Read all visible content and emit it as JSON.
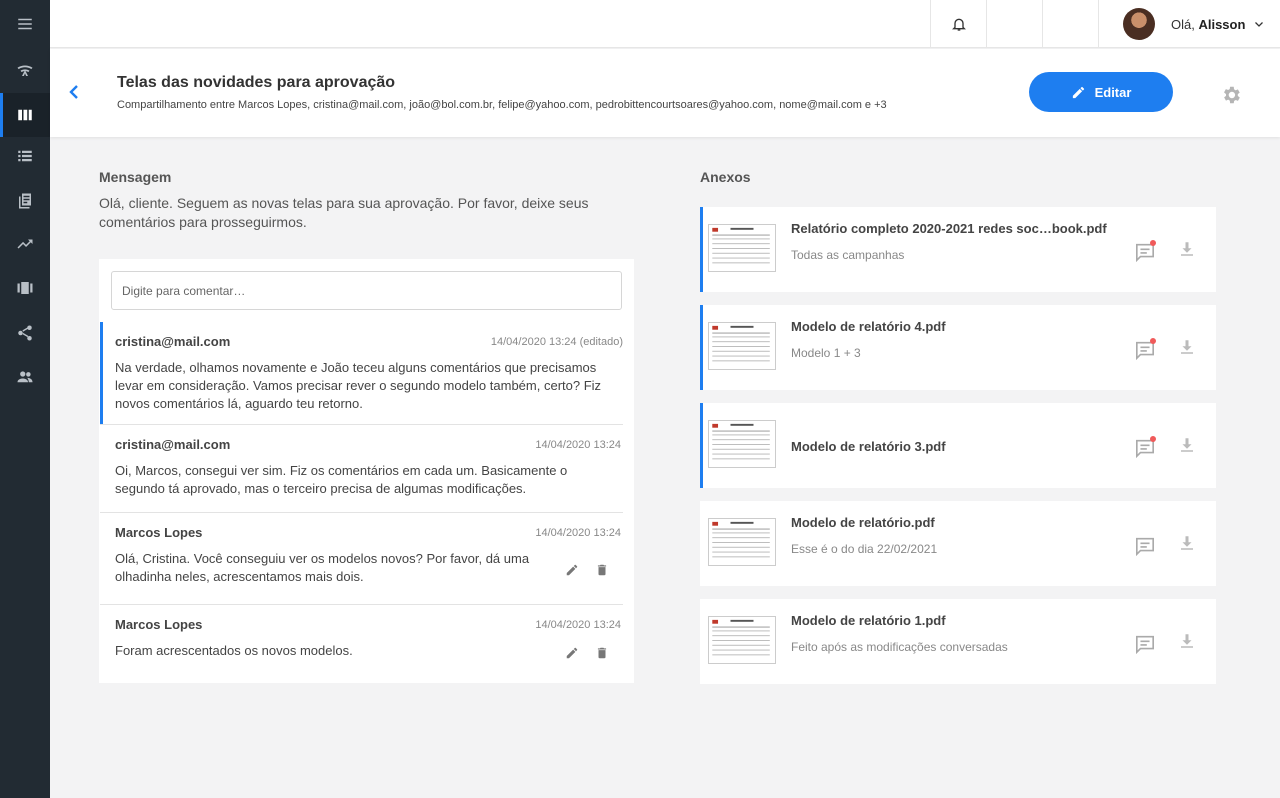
{
  "nav": {
    "items": [
      {
        "icon": "menu-icon"
      },
      {
        "icon": "signal-icon"
      },
      {
        "icon": "columns-icon",
        "active": true
      },
      {
        "icon": "list-icon"
      },
      {
        "icon": "book-icon"
      },
      {
        "icon": "trending-icon"
      },
      {
        "icon": "carousel-icon"
      },
      {
        "icon": "share-icon"
      },
      {
        "icon": "people-icon"
      }
    ]
  },
  "topbar": {
    "greeting_prefix": "Olá,",
    "user_name": "Alisson"
  },
  "header": {
    "title": "Telas das novidades para aprovação",
    "subtitle": "Compartilhamento entre Marcos Lopes, cristina@mail.com, joão@bol.com.br, felipe@yahoo.com, pedrobittencourtsoares@yahoo.com, nome@mail.com e +3",
    "edit_label": "Editar"
  },
  "message": {
    "label": "Mensagem",
    "text": "Olá, cliente. Seguem as novas telas para sua aprovação. Por favor, deixe seus comentários para prosseguirmos."
  },
  "comments": {
    "placeholder": "Digite para comentar…",
    "items": [
      {
        "author": "cristina@mail.com",
        "date": "14/04/2020 13:24 (editado)",
        "body": "Na verdade, olhamos novamente e João teceu alguns comentários que precisamos levar em consideração. Vamos precisar rever o segundo modelo também, certo? Fiz novos comentários lá, aguardo teu retorno."
      },
      {
        "author": "cristina@mail.com",
        "date": "14/04/2020 13:24",
        "body": "Oi, Marcos, consegui ver sim. Fiz os comentários em cada um. Basicamente o segundo tá aprovado, mas o terceiro precisa de algumas modificações."
      },
      {
        "author": "Marcos Lopes",
        "date": "14/04/2020 13:24",
        "body": "Olá, Cristina. Você conseguiu ver os modelos novos? Por favor, dá uma olhadinha neles, acrescentamos mais dois."
      },
      {
        "author": "Marcos Lopes",
        "date": "14/04/2020 13:24",
        "body": "Foram acrescentados os novos modelos."
      }
    ]
  },
  "attachments": {
    "label": "Anexos",
    "items": [
      {
        "name": "Relatório completo 2020-2021 redes soc…book.pdf",
        "desc": "Todas as campanhas",
        "new_comments": true
      },
      {
        "name": "Modelo de relatório 4.pdf",
        "desc": "Modelo 1 + 3",
        "new_comments": true
      },
      {
        "name": "Modelo de relatório 3.pdf",
        "desc": "",
        "new_comments": true
      },
      {
        "name": "Modelo de relatório.pdf",
        "desc": "Esse é o do dia 22/02/2021",
        "new_comments": false
      },
      {
        "name": "Modelo de relatório 1.pdf",
        "desc": "Feito após as modificações conversadas",
        "new_comments": false
      }
    ]
  },
  "colors": {
    "accent": "#1e7ef0",
    "sidebar": "#222b33",
    "notification_dot": "#f05a5a"
  }
}
